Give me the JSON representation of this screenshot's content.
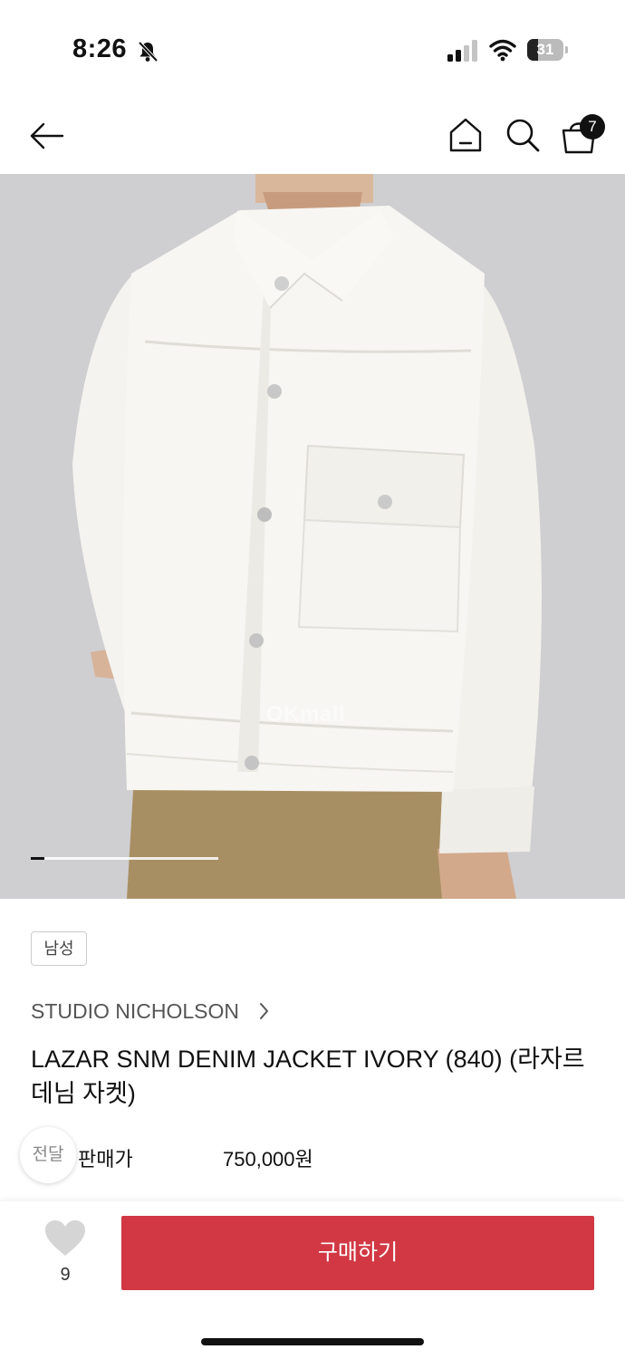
{
  "status_bar": {
    "time": "8:26",
    "battery_level": "31",
    "icons": [
      "bell-slash-icon",
      "signal-icon",
      "wifi-icon",
      "battery-icon"
    ]
  },
  "header": {
    "cart_count": "7",
    "icons": [
      "arrow-left-icon",
      "home-icon",
      "search-icon",
      "shopping-bag-icon"
    ]
  },
  "gallery": {
    "watermark": "OKmall",
    "current_index": 1
  },
  "product": {
    "tag": "남성",
    "brand": "STUDIO NICHOLSON",
    "name": "LAZAR SNM DENIM JACKET IVORY (840) (라자르 데님 자켓)",
    "price_label": "판매가",
    "price": "750,000원",
    "floating_button_label": "전달"
  },
  "bottom_bar": {
    "like_count": "9",
    "buy_label": "구매하기"
  },
  "colors": {
    "accent": "#d13843",
    "image_background": "#cfcfd2"
  }
}
